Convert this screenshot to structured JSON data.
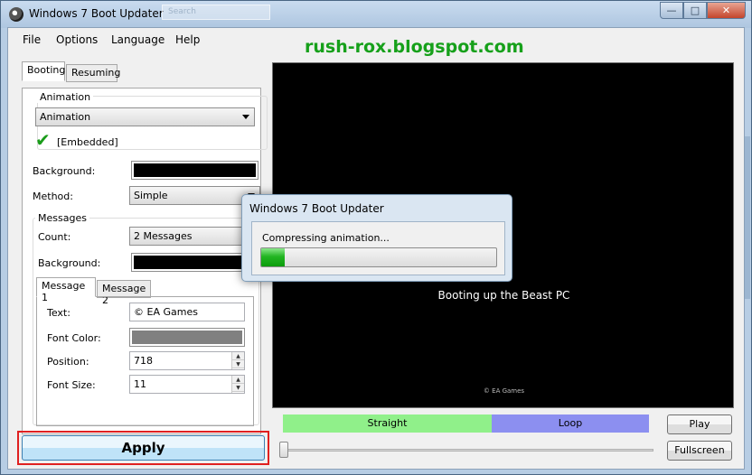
{
  "window": {
    "title": "Windows 7 Boot Updater",
    "ghost_tab": "Search"
  },
  "menu": [
    "File",
    "Options",
    "Language",
    "Help"
  ],
  "site": "rush-rox.blogspot.com",
  "tabs": {
    "booting": "Booting",
    "resuming": "Resuming"
  },
  "animation": {
    "group": "Animation",
    "selected": "Animation",
    "source": "[Embedded]"
  },
  "background_label": "Background:",
  "background_color": "#000000",
  "method": {
    "label": "Method:",
    "value": "Simple"
  },
  "messages": {
    "group": "Messages",
    "count_label": "Count:",
    "count_value": "2 Messages",
    "background_label": "Background:",
    "background_color": "#000000"
  },
  "message_tabs": {
    "tab1": "Message 1",
    "tab2": "Message 2"
  },
  "message": {
    "text_label": "Text:",
    "text_value": "© EA Games",
    "font_color_label": "Font Color:",
    "font_color": "#808080",
    "position_label": "Position:",
    "position_value": "718",
    "font_size_label": "Font Size:",
    "font_size_value": "11"
  },
  "preview": {
    "boot_text": "Booting up the Beast PC",
    "copyright": "© EA Games"
  },
  "dialog": {
    "title": "Windows 7 Boot Updater",
    "message": "Compressing animation...",
    "progress_fraction": 0.1
  },
  "timeline": {
    "straight": "Straight",
    "loop": "Loop",
    "straight_fraction": 0.57
  },
  "buttons": {
    "play": "Play",
    "fullscreen": "Fullscreen",
    "apply": "Apply"
  },
  "colors": {
    "accent_green": "#16a01a",
    "straight": "#90f08a",
    "loop": "#8c8ff0"
  }
}
